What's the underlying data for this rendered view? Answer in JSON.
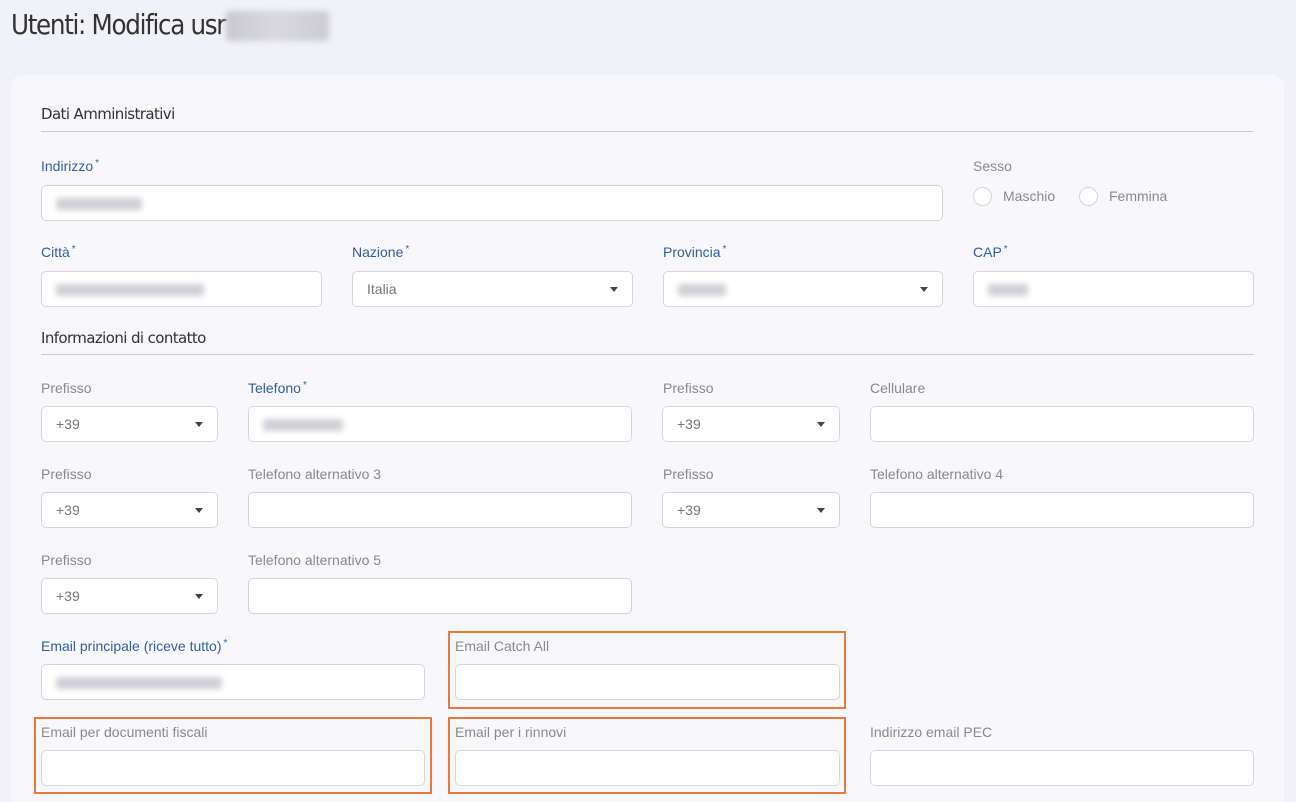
{
  "page": {
    "title": "Utenti: Modifica usr"
  },
  "sections": {
    "admin": "Dati Amministrativi",
    "contact": "Informazioni di contatto"
  },
  "labels": {
    "indirizzo": "Indirizzo",
    "sesso": "Sesso",
    "maschio": "Maschio",
    "femmina": "Femmina",
    "citta": "Città",
    "nazione": "Nazione",
    "provincia": "Provincia",
    "cap": "CAP",
    "prefisso": "Prefisso",
    "telefono": "Telefono",
    "cellulare": "Cellulare",
    "tel_alt_3": "Telefono alternativo 3",
    "tel_alt_4": "Telefono alternativo 4",
    "tel_alt_5": "Telefono alternativo 5",
    "email_principale": "Email principale (riceve tutto)",
    "email_catch_all": "Email Catch All",
    "email_doc_fiscali": "Email per documenti fiscali",
    "email_rinnovi": "Email per i rinnovi",
    "email_pec": "Indirizzo email PEC",
    "required_mark": "*"
  },
  "values": {
    "nazione": "Italia",
    "prefisso_telefono": "+39",
    "prefisso_cellulare": "+39",
    "prefisso_alt_3": "+39",
    "prefisso_alt_4": "+39",
    "prefisso_alt_5": "+39",
    "cellulare": "",
    "tel_alt_3": "",
    "tel_alt_4": "",
    "tel_alt_5": "",
    "email_catch_all": "",
    "email_doc_fiscali": "",
    "email_rinnovi": "",
    "email_pec": ""
  },
  "colors": {
    "required_label": "#2f5f9e",
    "highlight_border": "#e87a3b",
    "page_bg": "#f1f1f8"
  }
}
